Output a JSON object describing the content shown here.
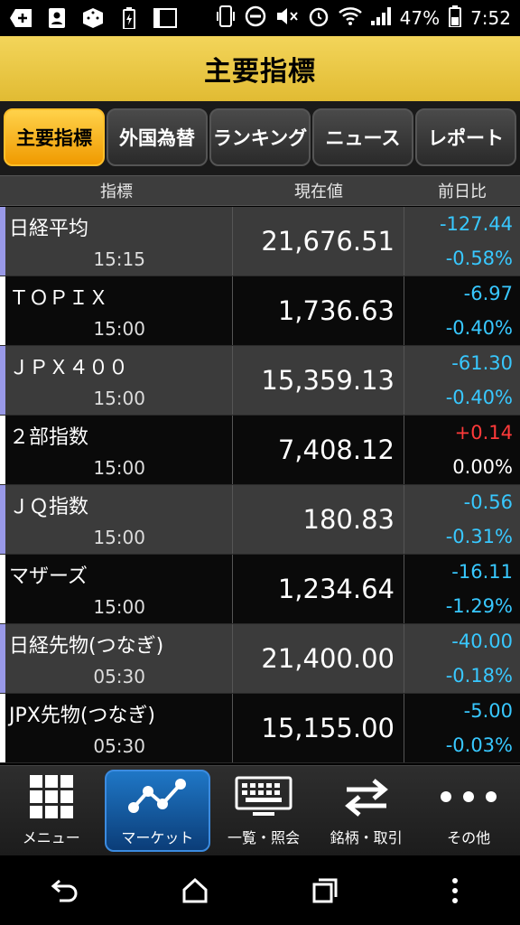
{
  "status": {
    "battery_pct": "47%",
    "time": "7:52"
  },
  "header": {
    "title": "主要指標"
  },
  "tabs": [
    {
      "label": "主要指標",
      "active": true
    },
    {
      "label": "外国為替",
      "active": false
    },
    {
      "label": "ランキング",
      "active": false
    },
    {
      "label": "ニュース",
      "active": false
    },
    {
      "label": "レポート",
      "active": false
    }
  ],
  "columns": {
    "name": "指標",
    "price": "現在値",
    "change": "前日比"
  },
  "rows": [
    {
      "name": "日経平均",
      "time": "15:15",
      "price": "21,676.51",
      "change": "-127.44",
      "change_pct": "-0.58%",
      "dir": "neg"
    },
    {
      "name": "ＴＯＰＩＸ",
      "time": "15:00",
      "price": "1,736.63",
      "change": "-6.97",
      "change_pct": "-0.40%",
      "dir": "neg"
    },
    {
      "name": "ＪＰＸ４００",
      "time": "15:00",
      "price": "15,359.13",
      "change": "-61.30",
      "change_pct": "-0.40%",
      "dir": "neg"
    },
    {
      "name": "２部指数",
      "time": "15:00",
      "price": "7,408.12",
      "change": "+0.14",
      "change_pct": "0.00%",
      "dir": "pos"
    },
    {
      "name": "ＪＱ指数",
      "time": "15:00",
      "price": "180.83",
      "change": "-0.56",
      "change_pct": "-0.31%",
      "dir": "neg"
    },
    {
      "name": "マザーズ",
      "time": "15:00",
      "price": "1,234.64",
      "change": "-16.11",
      "change_pct": "-1.29%",
      "dir": "neg"
    },
    {
      "name": "日経先物(つなぎ)",
      "time": "05:30",
      "price": "21,400.00",
      "change": "-40.00",
      "change_pct": "-0.18%",
      "dir": "neg"
    },
    {
      "name": "JPX先物(つなぎ)",
      "time": "05:30",
      "price": "15,155.00",
      "change": "-5.00",
      "change_pct": "-0.03%",
      "dir": "neg"
    }
  ],
  "toolbar": [
    {
      "label": "メニュー",
      "icon": "grid-icon",
      "active": false
    },
    {
      "label": "マーケット",
      "icon": "chart-line-icon",
      "active": true
    },
    {
      "label": "一覧・照会",
      "icon": "keyboard-monitor-icon",
      "active": false
    },
    {
      "label": "銘柄・取引",
      "icon": "swap-arrows-icon",
      "active": false
    },
    {
      "label": "その他",
      "icon": "more-dots-icon",
      "active": false
    }
  ],
  "colors": {
    "header": "#e8c440",
    "tab_active": "#f5a800",
    "negative": "#38c8ff",
    "positive": "#ff3a3a"
  }
}
